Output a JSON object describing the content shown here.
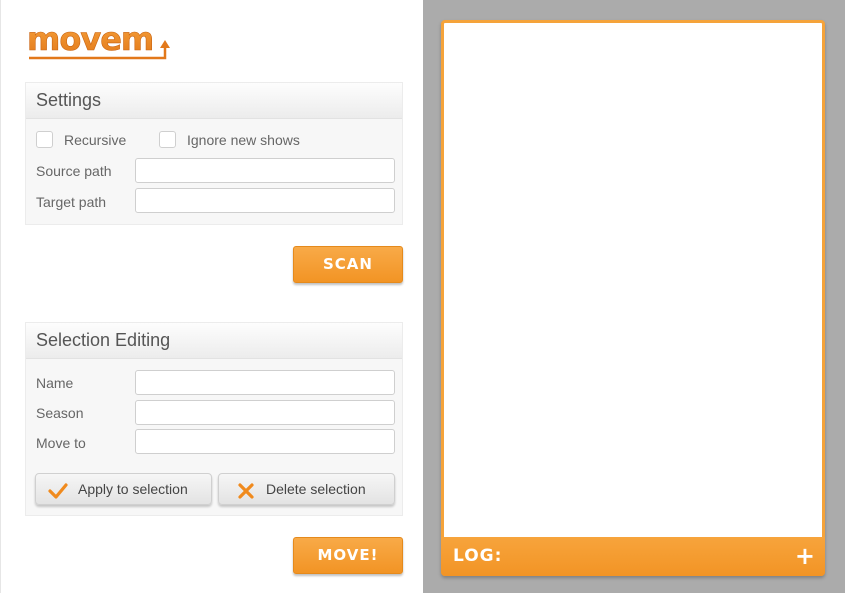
{
  "app": {
    "logo_text": "movem",
    "accent_color": "#f29425"
  },
  "settings": {
    "title": "Settings",
    "recursive_label": "Recursive",
    "ignore_new_shows_label": "Ignore new shows",
    "source_path_label": "Source path",
    "source_path_value": "",
    "target_path_label": "Target path",
    "target_path_value": ""
  },
  "scan_button": {
    "label": "SCAN"
  },
  "selection": {
    "title": "Selection Editing",
    "name_label": "Name",
    "name_value": "",
    "season_label": "Season",
    "season_value": "",
    "move_to_label": "Move to",
    "move_to_value": "",
    "apply_label": "Apply to selection",
    "apply_icon": "check-icon",
    "delete_label": "Delete selection",
    "delete_icon": "x-icon"
  },
  "move_button": {
    "label": "MOVE!"
  },
  "log": {
    "label": "LOG:",
    "expand_icon": "plus-icon",
    "content": ""
  }
}
